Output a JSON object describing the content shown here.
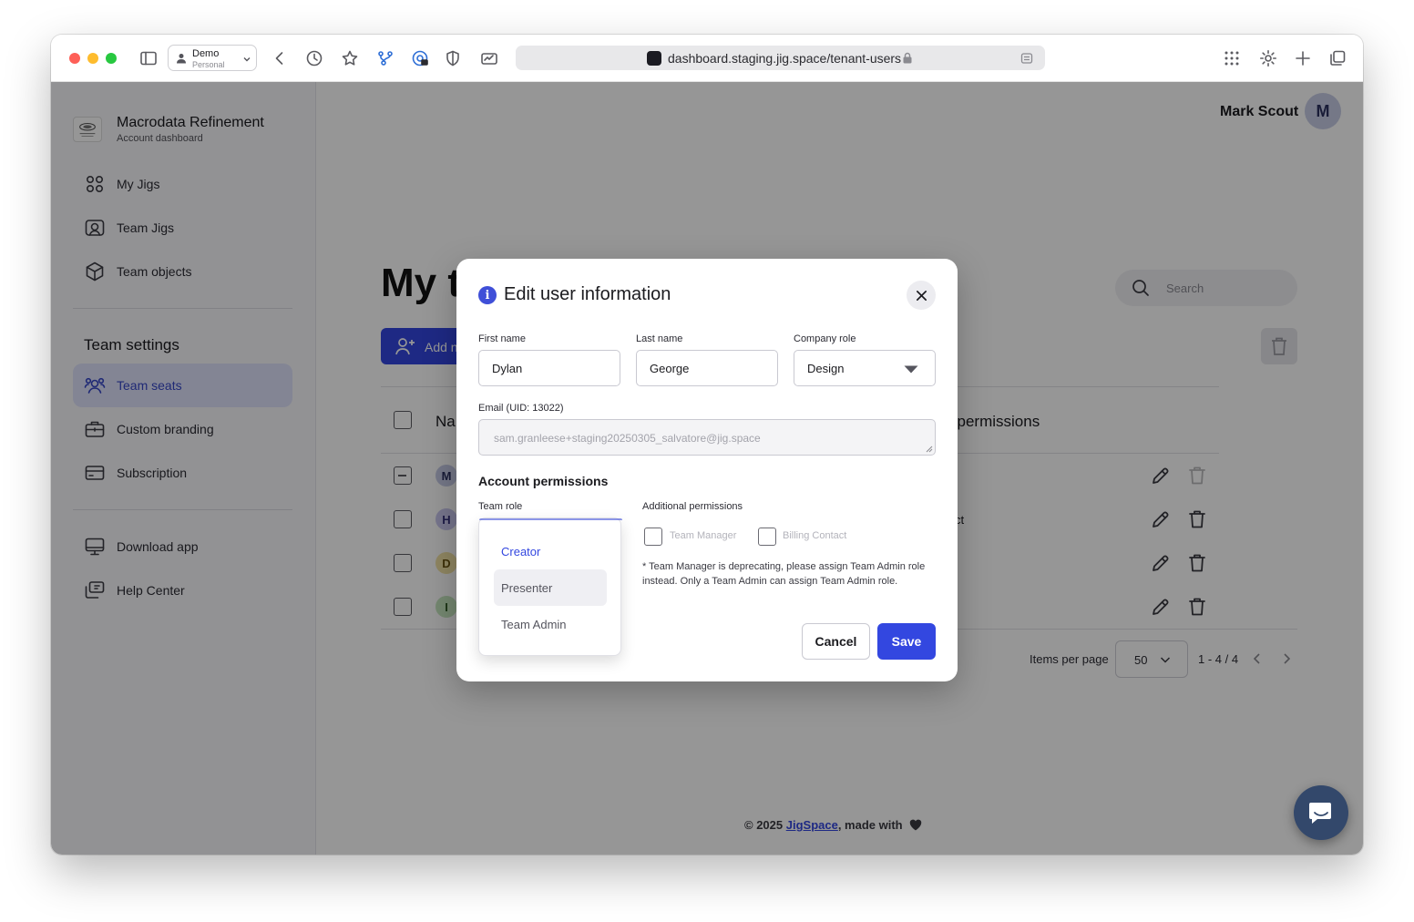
{
  "browser": {
    "profile_name": "Demo",
    "profile_type": "Personal",
    "url": "dashboard.staging.jig.space/tenant-users"
  },
  "sidebar": {
    "brand_name": "Macrodata Refinement",
    "brand_subtitle": "Account dashboard",
    "nav_items": [
      {
        "label": "My Jigs",
        "icon": "grid-icon"
      },
      {
        "label": "Team Jigs",
        "icon": "team-jigs-icon"
      },
      {
        "label": "Team objects",
        "icon": "cube-icon"
      }
    ],
    "settings_title": "Team settings",
    "settings_items": [
      {
        "label": "Team seats",
        "icon": "users-icon",
        "active": true
      },
      {
        "label": "Custom branding",
        "icon": "briefcase-icon"
      },
      {
        "label": "Subscription",
        "icon": "card-icon"
      }
    ],
    "help_items": [
      {
        "label": "Download app",
        "icon": "monitor-icon"
      },
      {
        "label": "Help Center",
        "icon": "help-icon"
      }
    ]
  },
  "header": {
    "user_name": "Mark Scout",
    "user_initial": "M"
  },
  "main": {
    "page_title": "My te",
    "search_placeholder": "Search",
    "add_button_label": "Add n",
    "table": {
      "col_name": "Na",
      "col_permissions": "l permissions",
      "rows": [
        {
          "initial": "M",
          "avatar_color": "#c6cbe6",
          "extra": ""
        },
        {
          "initial": "H",
          "avatar_color": "#c9c7ee",
          "extra": "ct"
        },
        {
          "initial": "D",
          "avatar_color": "#f1e3a5",
          "extra": ""
        },
        {
          "initial": "I",
          "avatar_color": "#c6e6bf",
          "extra": ""
        }
      ]
    },
    "pagination": {
      "items_per_page_label": "Items per page",
      "items_per_page_value": "50",
      "range": "1 - 4 / 4"
    },
    "footer": {
      "prefix": "© 2025 ",
      "link": "JigSpace",
      "suffix": ", made with"
    }
  },
  "modal": {
    "title": "Edit user information",
    "first_name_label": "First name",
    "first_name_value": "Dylan",
    "last_name_label": "Last name",
    "last_name_value": "George",
    "company_role_label": "Company role",
    "company_role_value": "Design",
    "email_label": "Email (UID: 13022)",
    "email_value": "sam.granleese+staging20250305_salvatore@jig.space",
    "account_permissions_title": "Account permissions",
    "team_role_label": "Team role",
    "team_role_options": [
      {
        "label": "Creator",
        "selected": true
      },
      {
        "label": "Presenter",
        "hover": true
      },
      {
        "label": "Team Admin"
      }
    ],
    "additional_permissions_label": "Additional permissions",
    "permission_team_manager": "Team Manager",
    "permission_billing_contact": "Billing Contact",
    "note": "* Team Manager is deprecating, please assign Team Admin role instead. Only a Team Admin can assign Team Admin role.",
    "cancel_label": "Cancel",
    "save_label": "Save"
  },
  "colors": {
    "accent": "#3347e0",
    "active_nav_bg": "#dfe3fb",
    "overlay": "rgba(0,0,0,0.41)"
  }
}
